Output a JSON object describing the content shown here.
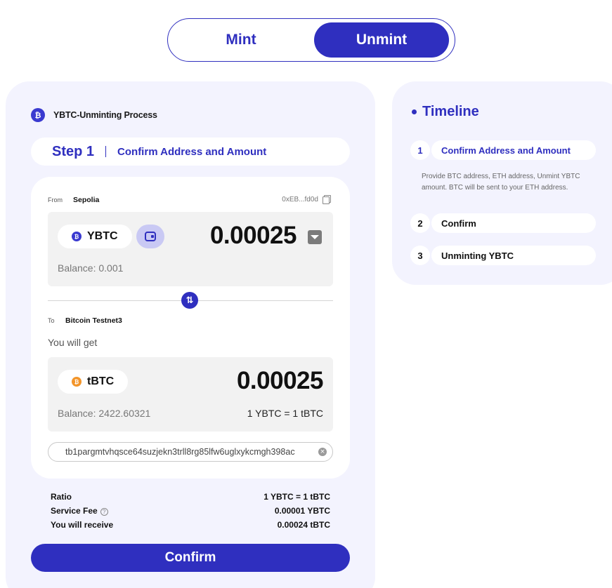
{
  "toggle": {
    "mint_label": "Mint",
    "unmint_label": "Unmint"
  },
  "process": {
    "title": "YBTC-Unminting Process",
    "coin_glyph": "₿"
  },
  "step": {
    "number": "Step 1",
    "title": "Confirm Address and Amount"
  },
  "from": {
    "label": "From",
    "network": "Sepolia",
    "address": "0xEB...fd0d",
    "token": "YBTC",
    "amount": "0.00025",
    "balance": "Balance: 0.001"
  },
  "swap_glyph": "⇅",
  "to": {
    "label": "To",
    "network": "Bitcoin Testnet3",
    "you_will_get": "You will get",
    "token": "tBTC",
    "amount": "0.00025",
    "balance": "Balance: 2422.60321",
    "rate": "1 YBTC = 1 tBTC"
  },
  "btc_address": {
    "value": "tb1pargmtvhqsce64suzjekn3trll8rg85lfw6uglxykcmgh398ac",
    "clear_glyph": "×"
  },
  "summary": {
    "ratio_label": "Ratio",
    "ratio_value": "1 YBTC = 1 tBTC",
    "fee_label": "Service Fee",
    "fee_help": "?",
    "fee_value": "0.00001 YBTC",
    "receive_label": "You will receive",
    "receive_value": "0.00024 tBTC"
  },
  "confirm_label": "Confirm",
  "timeline": {
    "title": "Timeline",
    "steps": [
      {
        "num": "1",
        "label": "Confirm Address and Amount"
      },
      {
        "num": "2",
        "label": "Confirm"
      },
      {
        "num": "3",
        "label": "Unminting YBTC"
      }
    ],
    "description": "Provide BTC address, ETH address, Unmint YBTC amount. BTC will be sent to your ETH address."
  },
  "colors": {
    "accent": "#2f2fbf",
    "panel_bg": "#f3f3fe",
    "btc_orange": "#f3952a"
  },
  "icons": [
    "ybtc-coin-icon",
    "wallet-icon",
    "copy-icon",
    "chevron-down-icon",
    "swap-icon",
    "tbtc-coin-icon",
    "clear-icon",
    "help-icon"
  ]
}
